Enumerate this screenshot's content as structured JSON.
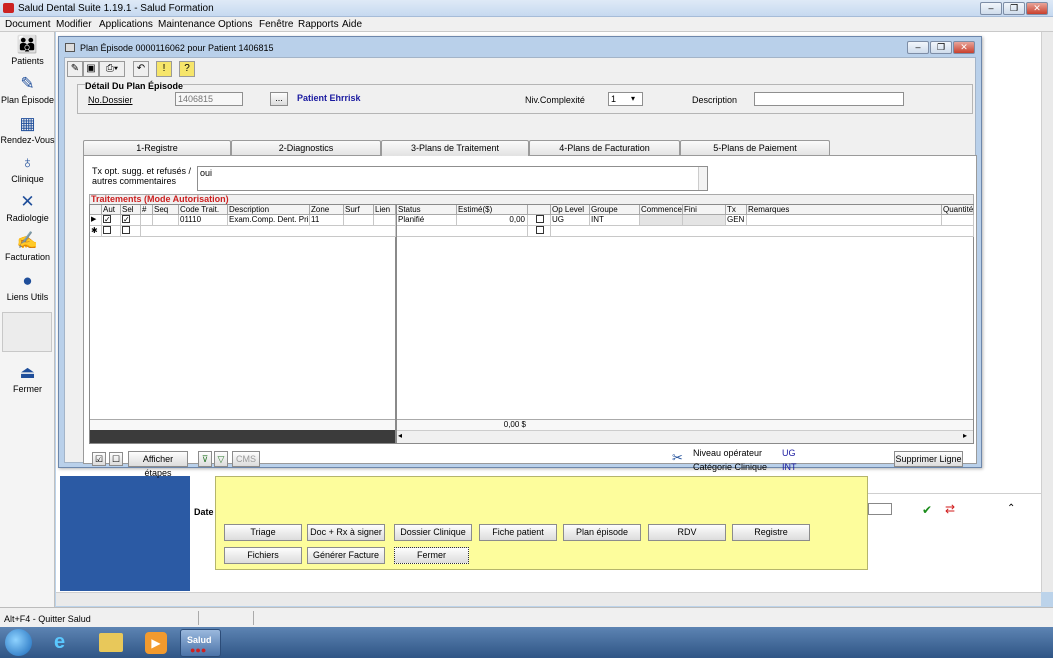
{
  "app": {
    "title": "Salud Dental Suite 1.19.1 - Salud Formation",
    "menu": [
      "Document",
      "Modifier",
      "Applications",
      "Maintenance",
      "Options",
      "Fenêtre",
      "Rapports",
      "Aide"
    ]
  },
  "sidebar": {
    "items": [
      {
        "label": "Patients",
        "icon": "👪"
      },
      {
        "label": "Plan Épisode",
        "icon": "✎"
      },
      {
        "label": "Rendez-Vous",
        "icon": "▦"
      },
      {
        "label": "Clinique",
        "icon": "♁"
      },
      {
        "label": "Radiologie",
        "icon": "✕"
      },
      {
        "label": "Facturation",
        "icon": "✍"
      },
      {
        "label": "Liens Utils",
        "icon": "●"
      },
      {
        "label": "Fermer",
        "icon": "⏏"
      }
    ]
  },
  "dialog": {
    "title": "Plan Épisode 0000116062 pour Patient 1406815",
    "group_title": "Détail Du Plan Épisode",
    "no_dossier_label": "No.Dossier",
    "no_dossier_value": "1406815",
    "browse_label": "...",
    "patient_name": "Patient Ehrrisk",
    "niv_complexite_label": "Niv.Complexité",
    "niv_complexite_value": "1",
    "description_label": "Description",
    "description_value": "",
    "tabs": [
      {
        "label": "1-Registre"
      },
      {
        "label": "2-Diagnostics"
      },
      {
        "label": "3-Plans de Traitement"
      },
      {
        "label": "4-Plans de Facturation"
      },
      {
        "label": "5-Plans de Paiement"
      }
    ],
    "comments_label": "Tx opt. sugg. et refusés / autres commentaires",
    "comments_value": "oui",
    "treatments_title": "Traitements (Mode Autorisation)",
    "left_headers": [
      "Aut",
      "Sel",
      "#",
      "Seq",
      "Code Trait.",
      "Description",
      "Zone",
      "Surf",
      "Lien"
    ],
    "right_headers": [
      "Status",
      "Estimé($)",
      "",
      "Op Level",
      "Groupe",
      "Commence",
      "Fini",
      "Tx",
      "Remarques",
      "Quantité"
    ],
    "row": {
      "code": "01110",
      "description": "Exam.Comp. Dent. Prim",
      "zone": "11",
      "status": "Planifié",
      "estime": "0,00",
      "op_level": "UG",
      "groupe": "INT",
      "tx": "GEN"
    },
    "total": "0,00 $",
    "afficher_etapes": "Afficher étapes",
    "cms_label": "CMS",
    "niveau_operateur_label": "Niveau opérateur",
    "niveau_operateur_value": "UG",
    "categorie_clinique_label": "Catégorie Clinique",
    "categorie_clinique_value": "INT",
    "supprimer_ligne": "Supprimer Ligne"
  },
  "background": {
    "date_label": "Date",
    "buttons_row1": [
      "Triage",
      "Doc + Rx à signer",
      "Dossier Clinique",
      "Fiche patient",
      "Plan épisode",
      "RDV",
      "Registre"
    ],
    "buttons_row2": [
      "Fichiers",
      "Générer Facture",
      "Fermer"
    ]
  },
  "status": {
    "text": "Alt+F4 - Quitter Salud"
  },
  "taskbar": {
    "app_label": "Salud"
  }
}
